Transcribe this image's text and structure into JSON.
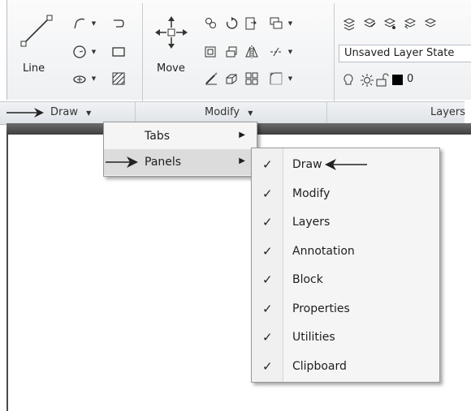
{
  "ribbon": {
    "line_label": "Line",
    "move_label": "Move",
    "layer_state": "Unsaved Layer State",
    "layer_number": "0",
    "panels": [
      "Draw",
      "Modify",
      "Layers"
    ]
  },
  "context_menu": {
    "items": [
      {
        "label": "Tabs",
        "submenu": true
      },
      {
        "label": "Panels",
        "submenu": true
      }
    ]
  },
  "panels_menu": {
    "items": [
      {
        "label": "Draw",
        "checked": true
      },
      {
        "label": "Modify",
        "checked": true
      },
      {
        "label": "Layers",
        "checked": true
      },
      {
        "label": "Annotation",
        "checked": true
      },
      {
        "label": "Block",
        "checked": true
      },
      {
        "label": "Properties",
        "checked": true
      },
      {
        "label": "Utilities",
        "checked": true
      },
      {
        "label": "Clipboard",
        "checked": true
      }
    ]
  },
  "glyphs": {
    "check": "✓",
    "submenu_arrow": "▶",
    "dropdown": "▼"
  },
  "colors": {
    "menu_bg": "#f5f5f5",
    "highlight": "#dcdcdc",
    "ribbon_strip": "#4a4a4a"
  }
}
